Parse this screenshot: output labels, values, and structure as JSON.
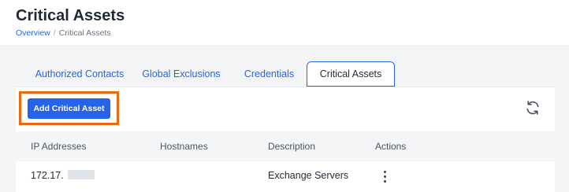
{
  "page": {
    "title": "Critical Assets",
    "breadcrumb": [
      {
        "label": "Overview"
      },
      {
        "label": "Critical Assets"
      }
    ],
    "breadcrumb_separator": "/"
  },
  "tabs": [
    {
      "label": "Authorized Contacts",
      "active": false
    },
    {
      "label": "Global Exclusions",
      "active": false
    },
    {
      "label": "Credentials",
      "active": false
    },
    {
      "label": "Critical Assets",
      "active": true
    }
  ],
  "toolbar": {
    "add_label": "Add Critical Asset",
    "refresh_icon": "refresh-icon",
    "highlight_color": "#ea6a14"
  },
  "table": {
    "columns": [
      "IP Addresses",
      "Hostnames",
      "Description",
      "Actions"
    ],
    "rows": [
      {
        "ip": "172.17.",
        "hostname": "",
        "description": "Exchange Servers",
        "actions_icon": "kebab-menu-icon"
      }
    ]
  },
  "colors": {
    "accent": "#2563eb",
    "highlight": "#ea6a14"
  }
}
